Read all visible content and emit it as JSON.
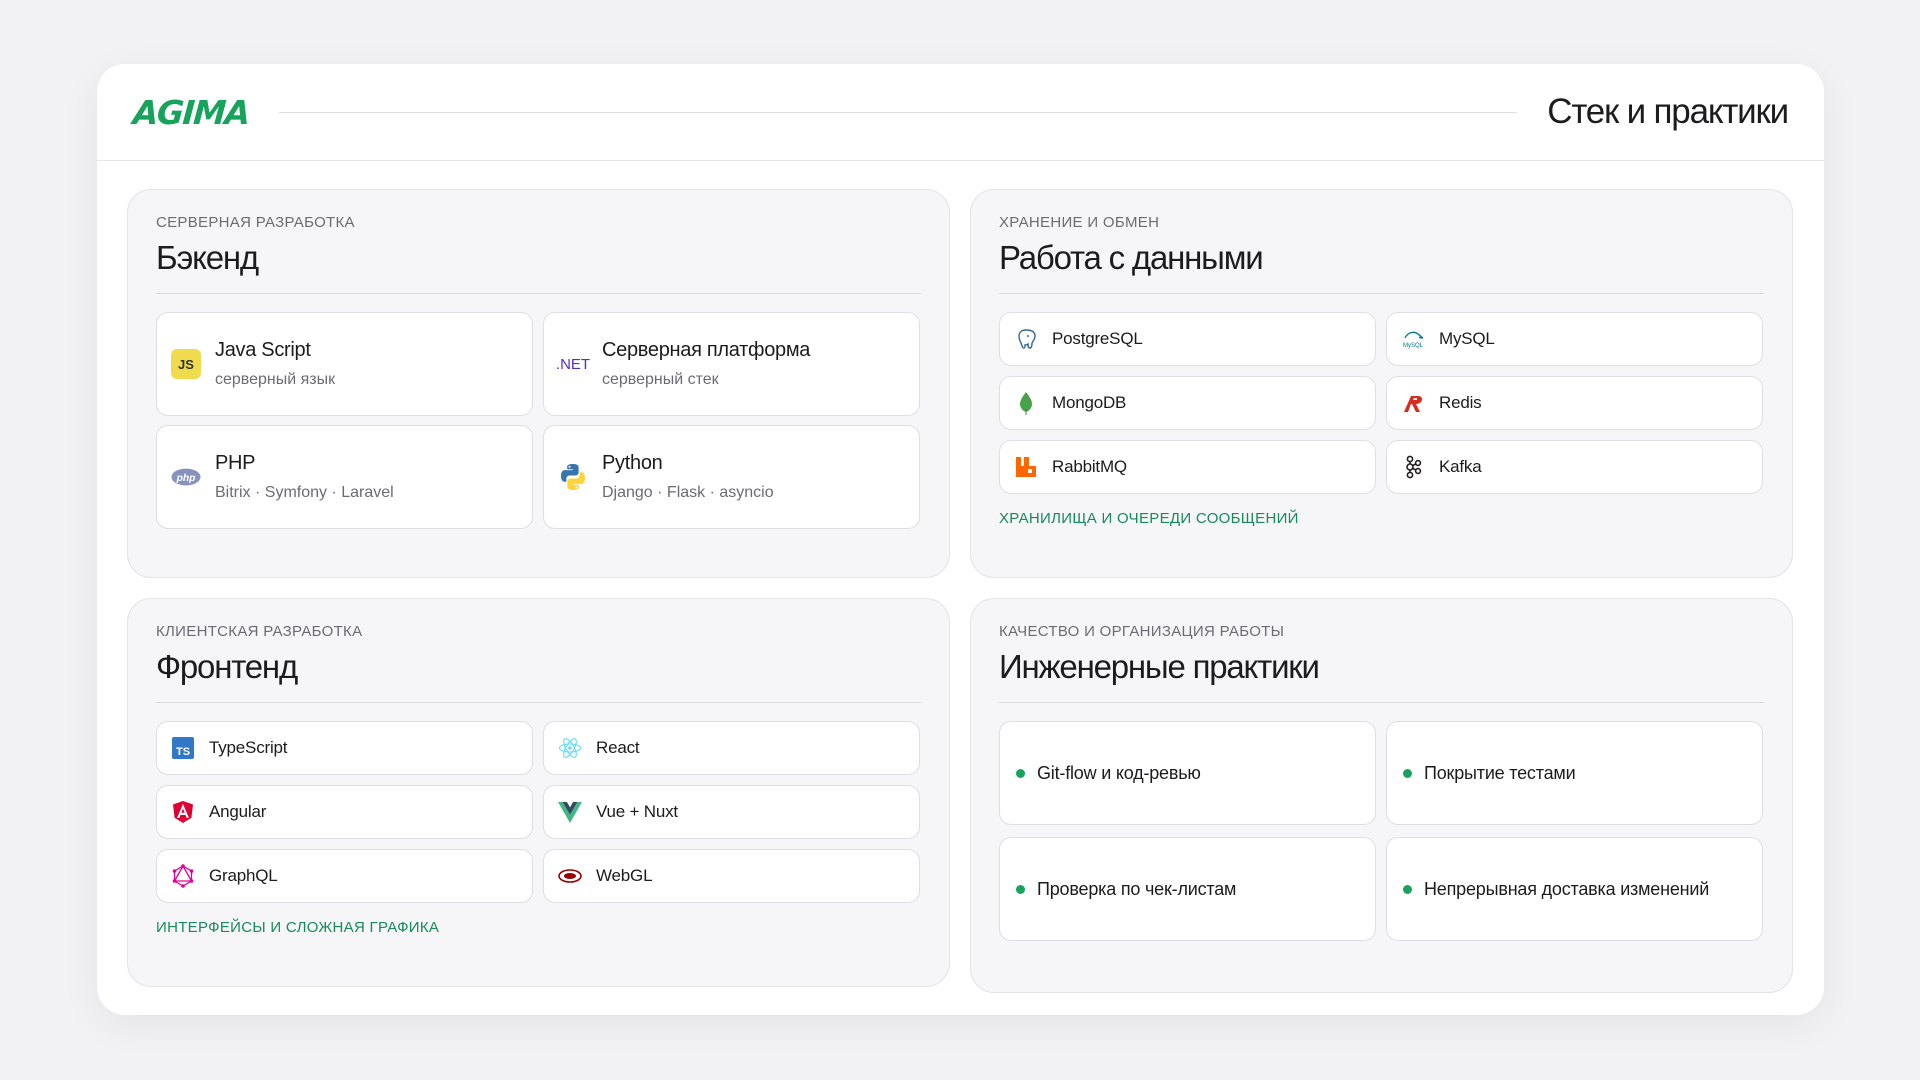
{
  "header": {
    "logo": "AGIMA",
    "title": "Стек и практики"
  },
  "backend": {
    "kicker": "Серверная разработка",
    "title": "Бэкенд",
    "items": [
      {
        "name": "Java Script",
        "sub": "серверный язык",
        "icon": "javascript-icon"
      },
      {
        "name": "Серверная платформа",
        "sub": "серверный стек",
        "icon": "dotnet-icon",
        "icon_text": ".NET"
      },
      {
        "name": "PHP",
        "sub": "Bitrix · Symfony · Laravel",
        "icon": "php-icon",
        "icon_text": "php"
      },
      {
        "name": "Python",
        "sub": "Django · Flask · asyncio",
        "icon": "python-icon"
      }
    ]
  },
  "data_work": {
    "kicker": "Хранение и обмен",
    "title": "Работа с данными",
    "items": [
      {
        "name": "PostgreSQL",
        "icon": "postgresql-icon"
      },
      {
        "name": "MySQL",
        "icon": "mysql-icon"
      },
      {
        "name": "MongoDB",
        "icon": "mongodb-icon"
      },
      {
        "name": "Redis",
        "icon": "redis-icon"
      },
      {
        "name": "RabbitMQ",
        "icon": "rabbitmq-icon"
      },
      {
        "name": "Kafka",
        "icon": "kafka-icon"
      }
    ],
    "footnote": "Хранилища и очереди сообщений"
  },
  "frontend": {
    "kicker": "Клиентская разработка",
    "title": "Фронтенд",
    "items": [
      {
        "name": "TypeScript",
        "icon": "typescript-icon"
      },
      {
        "name": "React",
        "icon": "react-icon"
      },
      {
        "name": "Angular",
        "icon": "angular-icon"
      },
      {
        "name": "Vue + Nuxt",
        "icon": "vue-icon"
      },
      {
        "name": "GraphQL",
        "icon": "graphql-icon"
      },
      {
        "name": "WebGL",
        "icon": "webgl-icon"
      }
    ],
    "footnote": "Интерфейсы и сложная графика"
  },
  "practices": {
    "kicker": "Качество и организация работы",
    "title": "Инженерные практики",
    "items": [
      {
        "label": "Git-flow и код-ревью"
      },
      {
        "label": "Покрытие тестами"
      },
      {
        "label": "Проверка по чек-листам"
      },
      {
        "label": "Непрерывная доставка изменений"
      }
    ]
  },
  "colors": {
    "accent": "#17a35b",
    "accent_text": "#17895a",
    "panel_bg": "#f6f6f8",
    "page_bg": "#f2f2f4"
  }
}
